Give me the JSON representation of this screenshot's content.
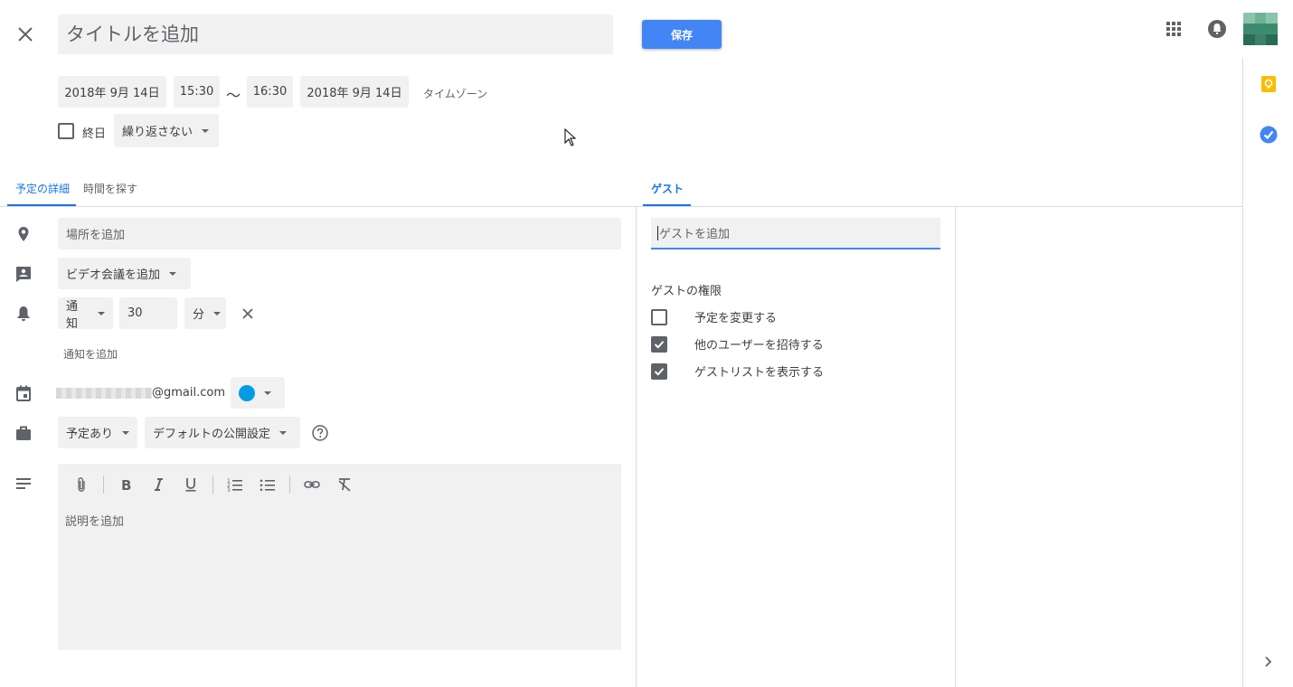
{
  "header": {
    "title_placeholder": "タイトルを追加",
    "save_label": "保存"
  },
  "datetime": {
    "start_date": "2018年 9月 14日",
    "start_time": "15:30",
    "separator": "〜",
    "end_time": "16:30",
    "end_date": "2018年 9月 14日",
    "timezone_label": "タイムゾーン",
    "all_day_label": "終日",
    "repeat_label": "繰り返さない"
  },
  "tabs": {
    "details": "予定の詳細",
    "find_time": "時間を探す",
    "guests": "ゲスト"
  },
  "details": {
    "location_placeholder": "場所を追加",
    "video_label": "ビデオ会議を追加",
    "notification_type": "通知",
    "notification_value": "30",
    "notification_unit": "分",
    "add_notification_label": "通知を追加",
    "calendar_email": "@gmail.com",
    "calendar_color": "#039be5",
    "availability": "予定あり",
    "visibility": "デフォルトの公開設定",
    "description_placeholder": "説明を追加"
  },
  "guests": {
    "add_placeholder": "ゲストを追加",
    "permissions_title": "ゲストの権限",
    "permissions": [
      {
        "label": "予定を変更する",
        "checked": false
      },
      {
        "label": "他のユーザーを招待する",
        "checked": true
      },
      {
        "label": "ゲストリストを表示する",
        "checked": true
      }
    ]
  },
  "colors": {
    "accent": "#4285f4",
    "keep_yellow": "#fbbc04",
    "tasks_blue": "#4285f4"
  }
}
